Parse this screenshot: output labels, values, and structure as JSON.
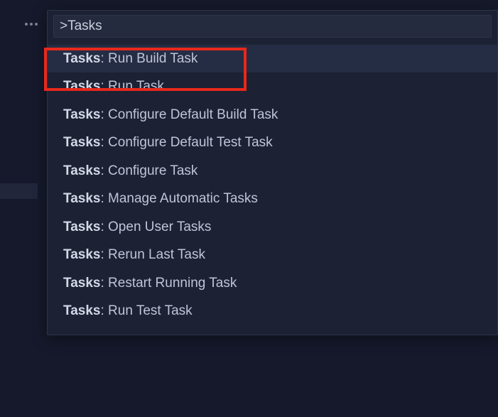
{
  "more_icon": "more-horizontal",
  "command_palette": {
    "input_value": ">Tasks",
    "results": [
      {
        "prefix": "Tasks",
        "rest": ": Run Build Task",
        "selected": true
      },
      {
        "prefix": "Tasks",
        "rest": ": Run Task",
        "selected": false
      },
      {
        "prefix": "Tasks",
        "rest": ": Configure Default Build Task",
        "selected": false
      },
      {
        "prefix": "Tasks",
        "rest": ": Configure Default Test Task",
        "selected": false
      },
      {
        "prefix": "Tasks",
        "rest": ": Configure Task",
        "selected": false
      },
      {
        "prefix": "Tasks",
        "rest": ": Manage Automatic Tasks",
        "selected": false
      },
      {
        "prefix": "Tasks",
        "rest": ": Open User Tasks",
        "selected": false
      },
      {
        "prefix": "Tasks",
        "rest": ": Rerun Last Task",
        "selected": false
      },
      {
        "prefix": "Tasks",
        "rest": ": Restart Running Task",
        "selected": false
      },
      {
        "prefix": "Tasks",
        "rest": ": Run Test Task",
        "selected": false
      }
    ]
  }
}
